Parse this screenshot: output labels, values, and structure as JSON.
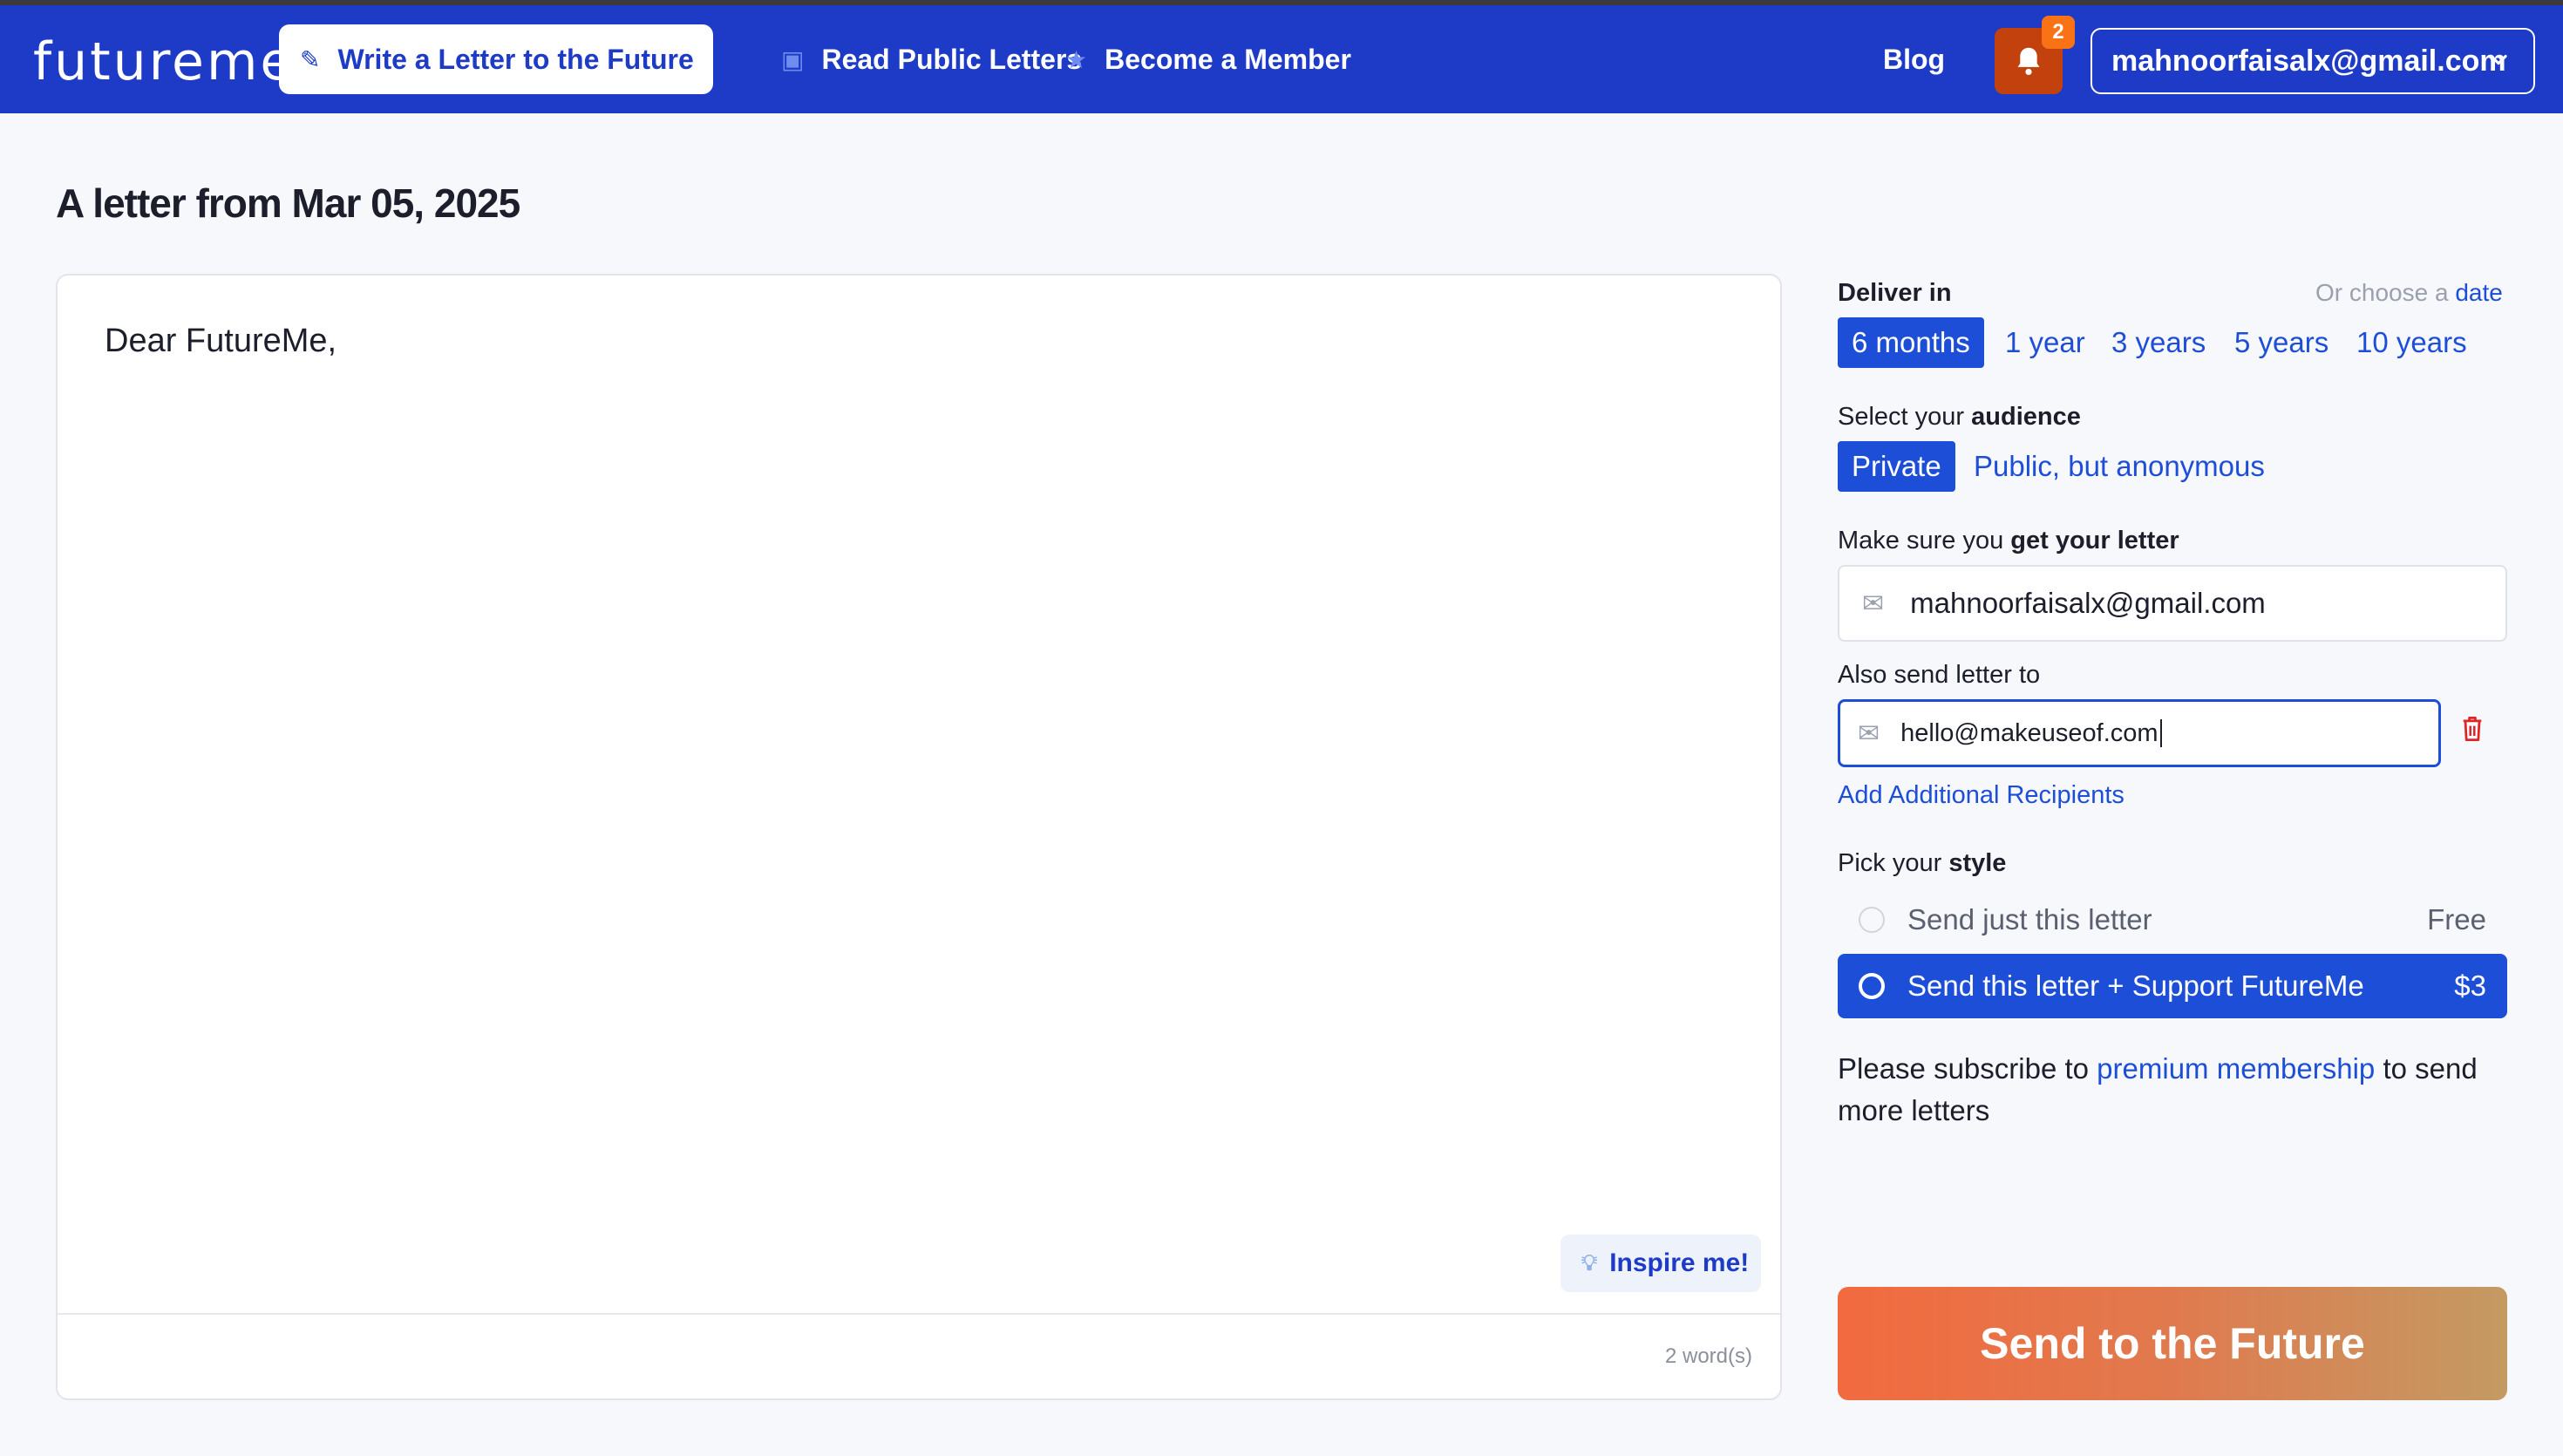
{
  "nav": {
    "logo_future": "future",
    "logo_me": "me",
    "write_label": "Write a Letter to the Future",
    "read_label": "Read Public Letters",
    "member_label": "Become a Member",
    "blog_label": "Blog",
    "notification_count": "2",
    "account_email": "mahnoorfaisalx@gmail.com"
  },
  "page": {
    "title": "A letter from Mar 05, 2025"
  },
  "editor": {
    "content": "Dear FutureMe,",
    "inspire_label": "Inspire me!",
    "word_count": "2 word(s)"
  },
  "delivery": {
    "label": "Deliver in",
    "choose_prefix": "Or choose a",
    "choose_link": "date",
    "options": [
      "6 months",
      "1 year",
      "3 years",
      "5 years",
      "10 years"
    ],
    "selected": "6 months"
  },
  "audience": {
    "label_prefix": "Select your",
    "label_bold": "audience",
    "options": [
      "Private",
      "Public, but anonymous"
    ],
    "selected": "Private"
  },
  "recipient": {
    "label_prefix": "Make sure you",
    "label_bold": "get your letter",
    "email": "mahnoorfaisalx@gmail.com",
    "also_label": "Also send letter to",
    "also_email": "hello@makeuseof.com",
    "add_label": "Add Additional Recipients"
  },
  "style": {
    "label_prefix": "Pick your",
    "label_bold": "style",
    "options": [
      {
        "label": "Send just this letter",
        "price": "Free"
      },
      {
        "label": "Send this letter + Support FutureMe",
        "price": "$3"
      }
    ]
  },
  "note": {
    "prefix": "Please subscribe to",
    "link": "premium membership",
    "suffix": "to send more letters"
  },
  "send_label": "Send to the Future",
  "colors": {
    "brand_blue": "#1d3bc6",
    "accent_blue": "#1d4ed8",
    "bell_orange": "#c2410c",
    "send_gradient_start": "#f26a3f",
    "send_gradient_end": "#c39a63"
  }
}
